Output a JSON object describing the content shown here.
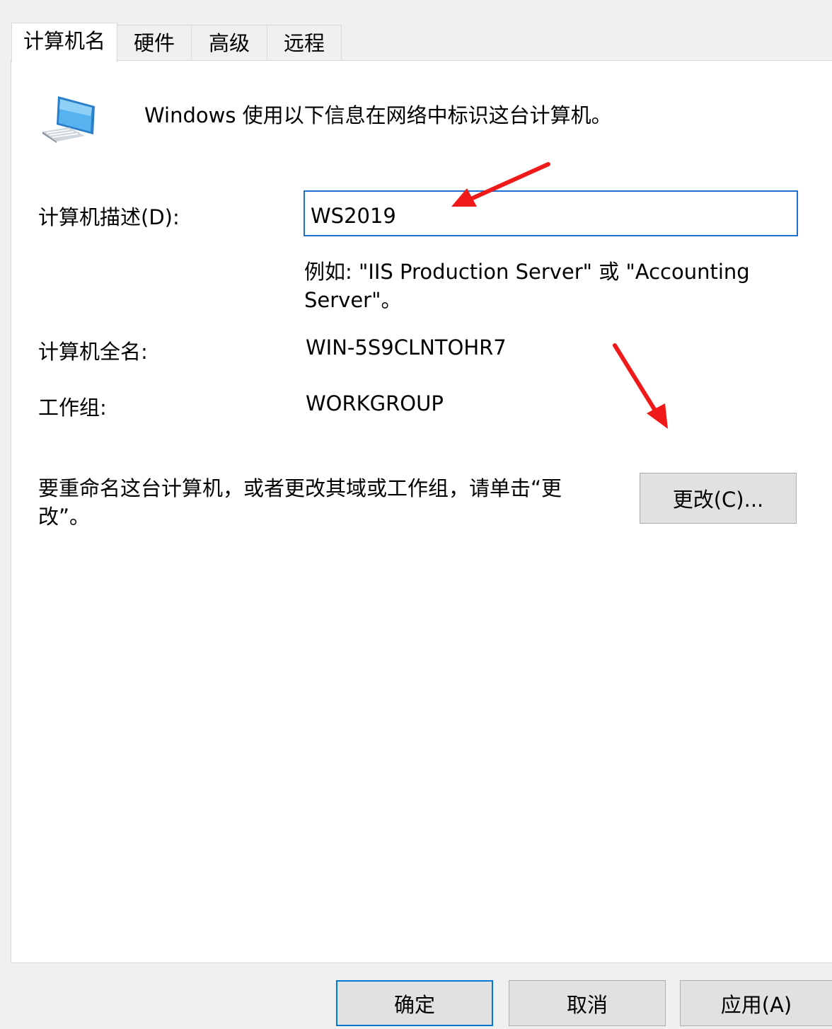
{
  "tabs": [
    {
      "label": "计算机名",
      "active": true
    },
    {
      "label": "硬件",
      "active": false
    },
    {
      "label": "高级",
      "active": false
    },
    {
      "label": "远程",
      "active": false
    }
  ],
  "panel": {
    "icon": "computer-monitor-icon",
    "intro": "Windows 使用以下信息在网络中标识这台计算机。",
    "description_label": "计算机描述(D):",
    "description_value": "WS2019",
    "example": "例如: \"IIS Production Server\" 或 \"Accounting Server\"。",
    "full_name_label": "计算机全名:",
    "full_name_value": "WIN-5S9CLNTOHR7",
    "workgroup_label": "工作组:",
    "workgroup_value": "WORKGROUP",
    "rename_text": "要重命名这台计算机，或者更改其域或工作组，请单击“更改”。",
    "change_button": "更改(C)..."
  },
  "footer": {
    "ok_button": "确定",
    "cancel_button": "取消",
    "apply_button": "应用(A)"
  },
  "colors": {
    "accent": "#0078d7",
    "annotation_arrow": "#f01a1a"
  }
}
